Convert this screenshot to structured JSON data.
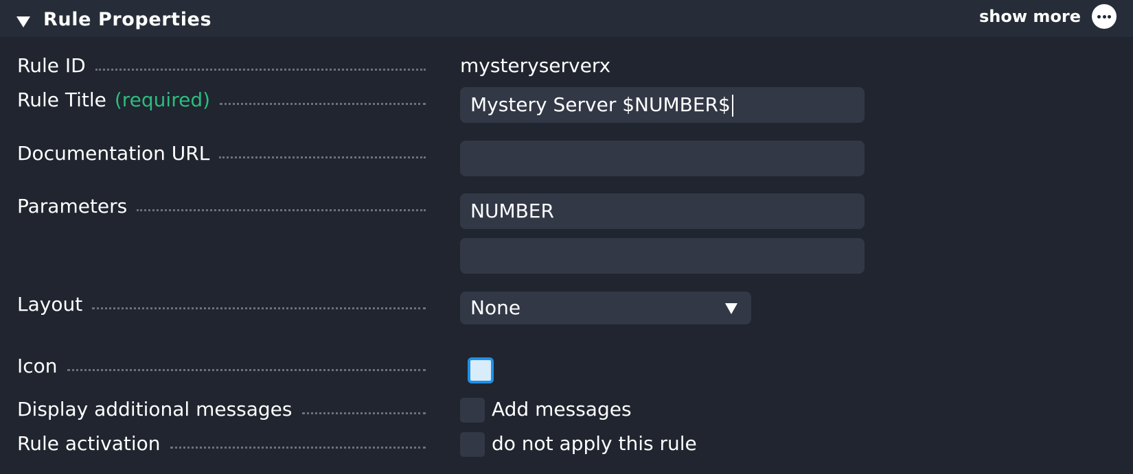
{
  "header": {
    "title": "Rule Properties",
    "show_more_label": "show more"
  },
  "rows": {
    "rule_id": {
      "label": "Rule ID",
      "value": "mysteryserverx"
    },
    "rule_title": {
      "label": "Rule Title",
      "required": "(required)",
      "value": "Mystery Server $NUMBER$"
    },
    "documentation_url": {
      "label": "Documentation URL",
      "value": ""
    },
    "parameters": {
      "label": "Parameters",
      "values": [
        "NUMBER",
        ""
      ]
    },
    "layout": {
      "label": "Layout",
      "selected": "None"
    },
    "icon": {
      "label": "Icon"
    },
    "display_messages": {
      "label": "Display additional messages",
      "checkbox_label": "Add messages",
      "checked": false
    },
    "rule_activation": {
      "label": "Rule activation",
      "checkbox_label": "do not apply this rule",
      "checked": false
    }
  },
  "icons": {
    "collapse": "triangle-down-icon",
    "more": "ellipsis-icon"
  },
  "colors": {
    "background": "#20252f",
    "header": "#272d38",
    "field": "#323846",
    "required": "#2bbd7e",
    "icon_border": "#1e90e8"
  }
}
